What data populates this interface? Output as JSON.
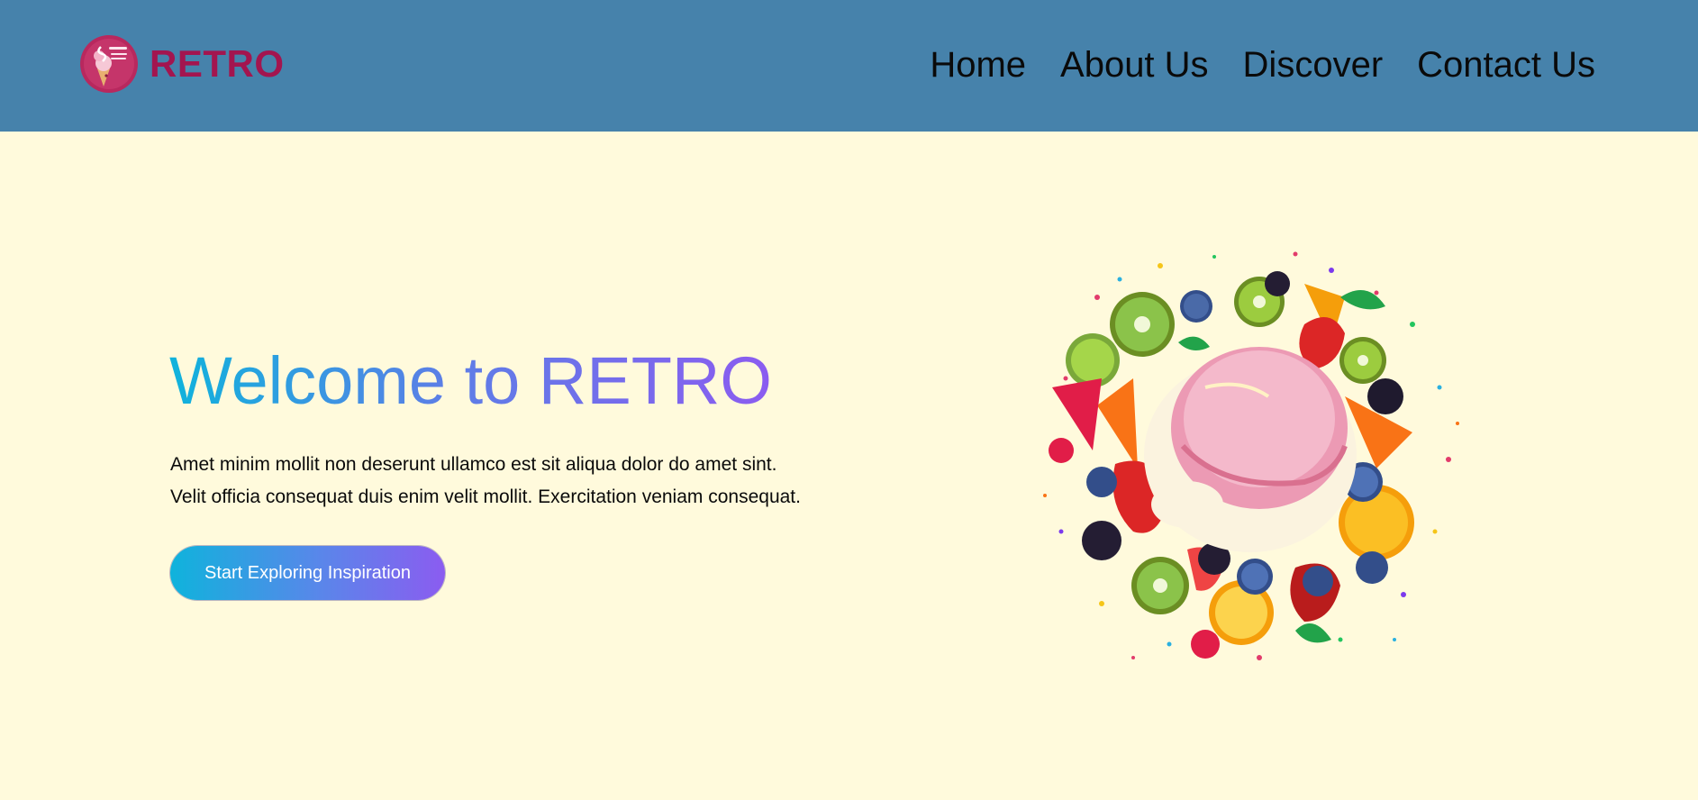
{
  "colors": {
    "header_bg": "#4682ab",
    "page_bg": "#fffadc",
    "brand": "#a3154f",
    "gradient_start": "#0fb3dc",
    "gradient_end": "#8b5cf0"
  },
  "header": {
    "logo": {
      "text": "RETRO",
      "badge_lettering": "Retro Strawberry Ice Cream",
      "icon": "ice-cream-logo-icon"
    },
    "nav": [
      {
        "label": "Home"
      },
      {
        "label": "About Us"
      },
      {
        "label": "Discover"
      },
      {
        "label": "Contact Us"
      }
    ]
  },
  "hero": {
    "title": "Welcome to RETRO",
    "text_line1": "Amet minim mollit non deserunt ullamco est sit aliqua dolor do amet sint.",
    "text_line2": "Velit officia consequat duis enim velit mollit. Exercitation veniam consequat.",
    "cta_label": "Start Exploring Inspiration",
    "image_icon": "ice-cream-fruit-illustration"
  }
}
